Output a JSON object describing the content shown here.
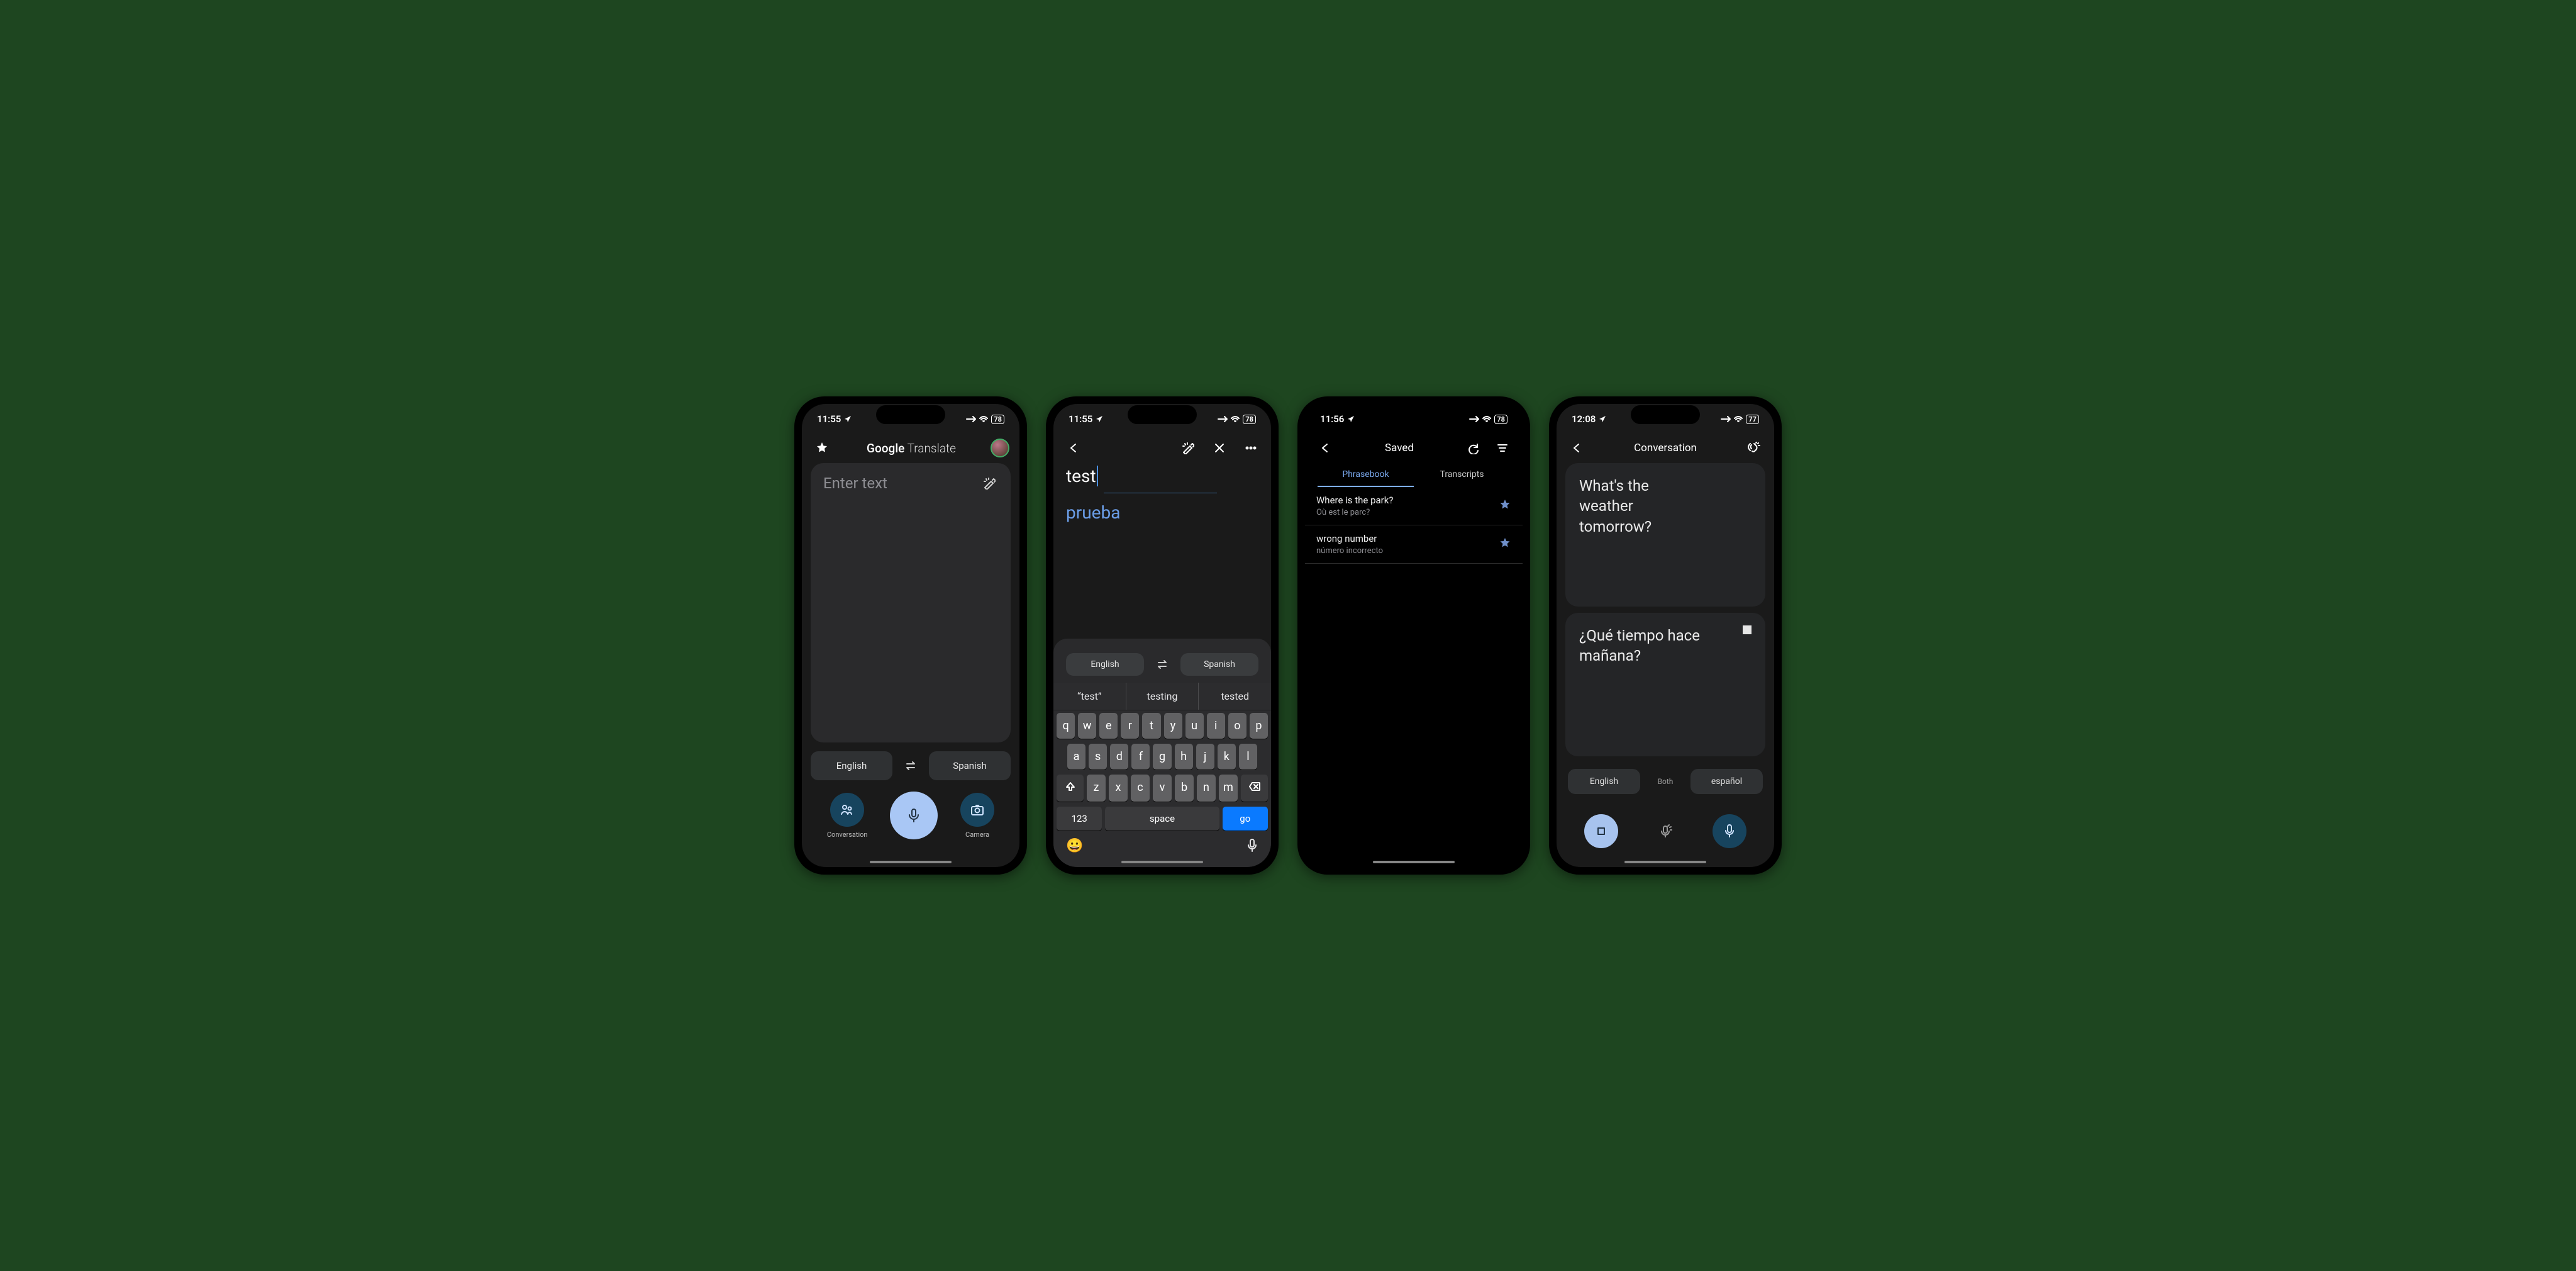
{
  "screens": [
    {
      "status": {
        "time": "11:55",
        "battery": "78"
      },
      "header": {
        "logo_google": "Google",
        "logo_translate": " Translate"
      },
      "input": {
        "placeholder": "Enter text"
      },
      "lang": {
        "from": "English",
        "to": "Spanish"
      },
      "modes": {
        "conversation": "Conversation",
        "camera": "Camera"
      }
    },
    {
      "status": {
        "time": "11:55",
        "battery": "78"
      },
      "text": {
        "input": "test",
        "output": "prueba"
      },
      "lang": {
        "from": "English",
        "to": "Spanish"
      },
      "suggestions": [
        "“test”",
        "testing",
        "tested"
      ],
      "keyboard": {
        "row1": [
          "q",
          "w",
          "e",
          "r",
          "t",
          "y",
          "u",
          "i",
          "o",
          "p"
        ],
        "row2": [
          "a",
          "s",
          "d",
          "f",
          "g",
          "h",
          "j",
          "k",
          "l"
        ],
        "row3": [
          "z",
          "x",
          "c",
          "v",
          "b",
          "n",
          "m"
        ],
        "num": "123",
        "space": "space",
        "go": "go"
      }
    },
    {
      "status": {
        "time": "11:56",
        "battery": "78"
      },
      "header": {
        "title": "Saved"
      },
      "tabs": {
        "phrasebook": "Phrasebook",
        "transcripts": "Transcripts"
      },
      "items": [
        {
          "src": "Where is the park?",
          "dst": "Où est le parc?"
        },
        {
          "src": "wrong number",
          "dst": "número incorrecto"
        }
      ]
    },
    {
      "status": {
        "time": "12:08",
        "battery": "77"
      },
      "header": {
        "title": "Conversation"
      },
      "bubbles": {
        "eng": "What's the\nweather\ntomorrow?",
        "esp": "¿Qué tiempo hace mañana?"
      },
      "lang": {
        "from": "English",
        "both": "Both",
        "to": "español"
      }
    }
  ]
}
